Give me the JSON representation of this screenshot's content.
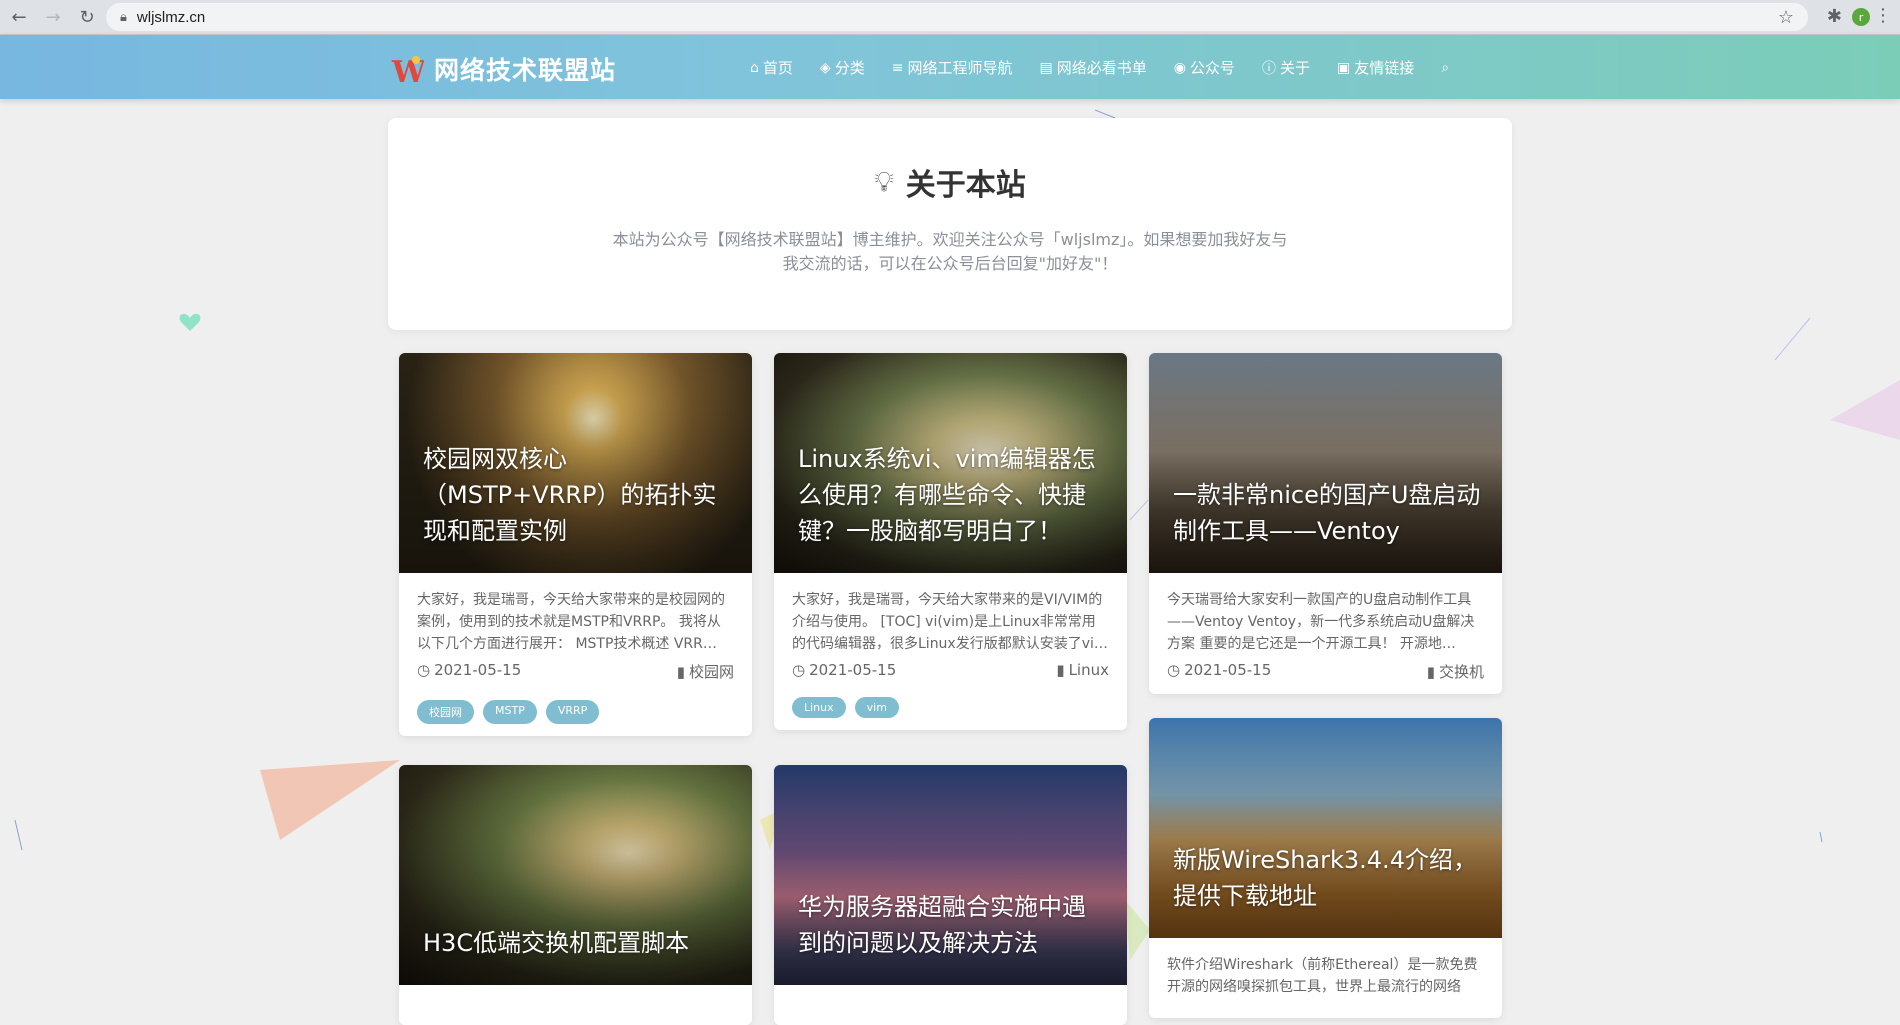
{
  "browser": {
    "url": "wljslmz.cn",
    "profile_initial": "r"
  },
  "site": {
    "name": "网络技术联盟站",
    "logo_letter": "W"
  },
  "nav": [
    {
      "icon": "home-icon",
      "glyph": "⌂",
      "label": "首页"
    },
    {
      "icon": "tags-icon",
      "glyph": "◈",
      "label": "分类"
    },
    {
      "icon": "list-icon",
      "glyph": "≡",
      "label": "网络工程师导航"
    },
    {
      "icon": "book-icon",
      "glyph": "▤",
      "label": "网络必看书单"
    },
    {
      "icon": "wechat-icon",
      "glyph": "◉",
      "label": "公众号"
    },
    {
      "icon": "info-icon",
      "glyph": "ⓘ",
      "label": "关于"
    },
    {
      "icon": "address-card-icon",
      "glyph": "▣",
      "label": "友情链接"
    }
  ],
  "about": {
    "title": "关于本站",
    "text": "本站为公众号【网络技术联盟站】博主维护。欢迎关注公众号「wljslmz」。如果想要加我好友与我交流的话，可以在公众号后台回复\"加好友\"！"
  },
  "posts": [
    {
      "title": "校园网双核心（MSTP+VRRP）的拓扑实现和配置实例",
      "excerpt": "大家好，我是瑞哥，今天给大家带来的是校园网的案例，使用到的技术就是MSTP和VRRP。 我将从以下几个方面进行展开： MSTP技术概述 VRR…",
      "date": "2021-05-15",
      "category": "校园网",
      "tags": [
        "校园网",
        "MSTP",
        "VRRP"
      ]
    },
    {
      "title": "Linux系统vi、vim编辑器怎么使用？有哪些命令、快捷键？一股脑都写明白了！",
      "excerpt": "大家好，我是瑞哥，今天给大家带来的是VI/VIM的介绍与使用。 [TOC] vi(vim)是上Linux非常常用的代码编辑器，很多Linux发行版都默认安装了vi…",
      "date": "2021-05-15",
      "category": "Linux",
      "tags": [
        "Linux",
        "vim"
      ]
    },
    {
      "title": "一款非常nice的国产U盘启动制作工具——Ventoy",
      "excerpt": "今天瑞哥给大家安利一款国产的U盘启动制作工具——Ventoy Ventoy，新一代多系统启动U盘解决方案 重要的是它还是一个开源工具！ 开源地…",
      "date": "2021-05-15",
      "category": "交换机",
      "tags": []
    },
    {
      "title": "H3C低端交换机配置脚本"
    },
    {
      "title": "华为服务器超融合实施中遇到的问题以及解决方法"
    },
    {
      "title": "新版WireShark3.4.4介绍，提供下载地址",
      "excerpt": "软件介绍Wireshark（前称Ethereal）是一款免费开源的网络嗅探抓包工具，世界上最流行的网络"
    }
  ]
}
